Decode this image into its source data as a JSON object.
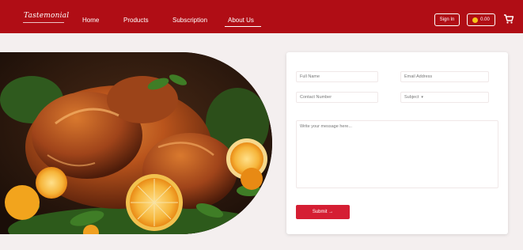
{
  "header": {
    "logo_text": "Tastemonial",
    "nav": [
      {
        "label": "Home"
      },
      {
        "label": "Products"
      },
      {
        "label": "Subscription"
      },
      {
        "label": "About Us"
      }
    ],
    "signin_label": "Sign In",
    "coin_label": "0.00",
    "brand_color": "#b00d15"
  },
  "form": {
    "full_name_placeholder": "Full Name",
    "email_placeholder": "Email Address",
    "contact_placeholder": "Contact Number",
    "subject_label": "Subject",
    "message_placeholder": "Write your message here...",
    "submit_label": "Submit →",
    "accent_color": "#d51e33"
  },
  "hero": {
    "image_subject": "roast-chicken-with-oranges-and-herbs"
  }
}
